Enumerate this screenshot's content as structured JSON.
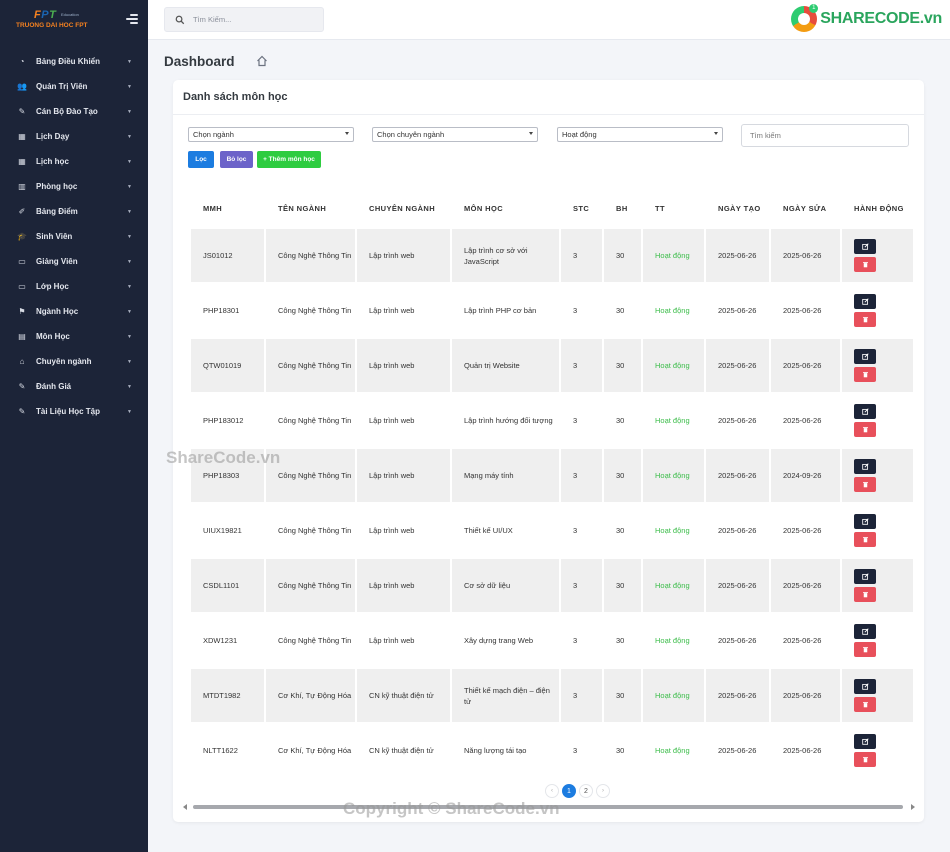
{
  "brand": {
    "logo_text": "FPT",
    "logo_sub": "Education",
    "university": "TRUONG DAI HOC FPT"
  },
  "sidebar": {
    "items": [
      {
        "label": "Bảng Điều Khiển",
        "icon": "gauge-icon"
      },
      {
        "label": "Quản Trị Viên",
        "icon": "users-icon"
      },
      {
        "label": "Cán Bộ Đào Tạo",
        "icon": "wrench-icon"
      },
      {
        "label": "Lịch Dạy",
        "icon": "calendar-icon"
      },
      {
        "label": "Lịch học",
        "icon": "calendar-icon"
      },
      {
        "label": "Phòng học",
        "icon": "building-icon"
      },
      {
        "label": "Bảng Điểm",
        "icon": "edit-book-icon"
      },
      {
        "label": "Sinh Viên",
        "icon": "graduation-cap-icon"
      },
      {
        "label": "Giảng Viên",
        "icon": "chalkboard-icon"
      },
      {
        "label": "Lớp Học",
        "icon": "laptop-icon"
      },
      {
        "label": "Ngành Học",
        "icon": "flag-icon"
      },
      {
        "label": "Môn Học",
        "icon": "book-icon"
      },
      {
        "label": "Chuyên ngành",
        "icon": "school-icon"
      },
      {
        "label": "Đánh Giá",
        "icon": "pencil-icon"
      },
      {
        "label": "Tài Liệu Học Tập",
        "icon": "pen-icon"
      }
    ]
  },
  "topbar": {
    "search_placeholder": "Tìm Kiếm...",
    "watermark_logo": "SHARECODE.vn",
    "watermark_badge": "1"
  },
  "page": {
    "title": "Dashboard"
  },
  "card": {
    "title": "Danh sách môn học"
  },
  "filters": {
    "major_placeholder": "Chọn ngành",
    "specialty_placeholder": "Chọn chuyên ngành",
    "status_value": "Hoạt động",
    "search_placeholder": "Tìm kiếm",
    "filter_button": "Lọc",
    "clear_button": "Bỏ lọc",
    "add_button": "+ Thêm môn học"
  },
  "table": {
    "headers": [
      "MMH",
      "TÊN NGÀNH",
      "CHUYÊN NGÀNH",
      "MÔN HỌC",
      "STC",
      "BH",
      "TT",
      "NGÀY TẠO",
      "NGÀY SỬA",
      "HÀNH ĐỘNG"
    ],
    "rows": [
      {
        "mmh": "JS01012",
        "nganh": "Công Nghệ Thông Tin",
        "chuyen": "Lập trình web",
        "mon": "Lập trình cơ sở với JavaScript",
        "stc": "3",
        "bh": "30",
        "tt": "Hoạt động",
        "tao": "2025-06-26",
        "sua": "2025-06-26"
      },
      {
        "mmh": "PHP18301",
        "nganh": "Công Nghệ Thông Tin",
        "chuyen": "Lập trình web",
        "mon": "Lập trình PHP cơ bản",
        "stc": "3",
        "bh": "30",
        "tt": "Hoạt động",
        "tao": "2025-06-26",
        "sua": "2025-06-26"
      },
      {
        "mmh": "QTW01019",
        "nganh": "Công Nghệ Thông Tin",
        "chuyen": "Lập trình web",
        "mon": "Quản trị Website",
        "stc": "3",
        "bh": "30",
        "tt": "Hoạt động",
        "tao": "2025-06-26",
        "sua": "2025-06-26"
      },
      {
        "mmh": "PHP183012",
        "nganh": "Công Nghệ Thông Tin",
        "chuyen": "Lập trình web",
        "mon": "Lập trình hướng đối tượng",
        "stc": "3",
        "bh": "30",
        "tt": "Hoạt động",
        "tao": "2025-06-26",
        "sua": "2025-06-26"
      },
      {
        "mmh": "PHP18303",
        "nganh": "Công Nghệ Thông Tin",
        "chuyen": "Lập trình web",
        "mon": "Mạng máy tính",
        "stc": "3",
        "bh": "30",
        "tt": "Hoạt động",
        "tao": "2025-06-26",
        "sua": "2024-09-26"
      },
      {
        "mmh": "UIUX19821",
        "nganh": "Công Nghệ Thông Tin",
        "chuyen": "Lập trình web",
        "mon": "Thiết kế UI/UX",
        "stc": "3",
        "bh": "30",
        "tt": "Hoạt động",
        "tao": "2025-06-26",
        "sua": "2025-06-26"
      },
      {
        "mmh": "CSDL1101",
        "nganh": "Công Nghệ Thông Tin",
        "chuyen": "Lập trình web",
        "mon": "Cơ sở dữ liệu",
        "stc": "3",
        "bh": "30",
        "tt": "Hoạt động",
        "tao": "2025-06-26",
        "sua": "2025-06-26"
      },
      {
        "mmh": "XDW1231",
        "nganh": "Công Nghệ Thông Tin",
        "chuyen": "Lập trình web",
        "mon": "Xây dựng trang Web",
        "stc": "3",
        "bh": "30",
        "tt": "Hoạt động",
        "tao": "2025-06-26",
        "sua": "2025-06-26"
      },
      {
        "mmh": "MTDT1982",
        "nganh": "Cơ Khí, Tự Động Hóa",
        "chuyen": "CN kỹ thuật điện tử",
        "mon": "Thiết kế mạch điện – điện tử",
        "stc": "3",
        "bh": "30",
        "tt": "Hoạt động",
        "tao": "2025-06-26",
        "sua": "2025-06-26"
      },
      {
        "mmh": "NLTT1622",
        "nganh": "Cơ Khí, Tự Động Hóa",
        "chuyen": "CN kỹ thuật điện tử",
        "mon": "Năng lượng tái tạo",
        "stc": "3",
        "bh": "30",
        "tt": "Hoạt động",
        "tao": "2025-06-26",
        "sua": "2025-06-26"
      }
    ]
  },
  "pagination": {
    "prev": "‹",
    "pages": [
      "1",
      "2"
    ],
    "next": "›",
    "current": "1"
  },
  "watermarks": {
    "middle": "ShareCode.vn",
    "bottom": "Copyright © ShareCode.vn"
  },
  "colors": {
    "sidebar_bg": "#1c2438",
    "primary": "#1c7ce0",
    "success": "#2ecc40",
    "danger": "#e8505b",
    "status_active": "#3cbd4a"
  }
}
